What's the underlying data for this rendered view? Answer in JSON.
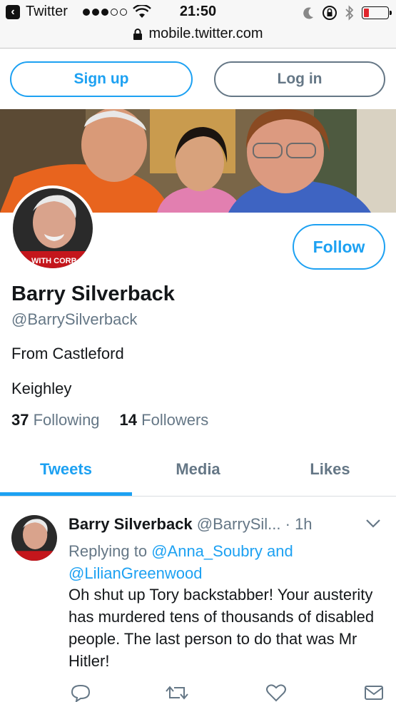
{
  "status_bar": {
    "app": "Twitter",
    "time": "21:50",
    "back_icon": "back-arrow-icon",
    "battery_color": "#e0262d"
  },
  "url_bar": {
    "url": "mobile.twitter.com"
  },
  "auth": {
    "signup_label": "Sign up",
    "login_label": "Log in"
  },
  "profile": {
    "name": "Barry Silverback",
    "handle": "@BarrySilverback",
    "follow_label": "Follow",
    "bio_line1": "From Castleford",
    "bio_line2": "Keighley",
    "following_count": "37",
    "following_label": "Following",
    "followers_count": "14",
    "followers_label": "Followers",
    "avatar_banner_text": "WITH CORB"
  },
  "tabs": [
    {
      "label": "Tweets",
      "active": true
    },
    {
      "label": "Media",
      "active": false
    },
    {
      "label": "Likes",
      "active": false
    }
  ],
  "tweet": {
    "name": "Barry Silverback",
    "handle": "@BarrySil...",
    "separator": "·",
    "time": "1h",
    "replying_prefix": "Replying to",
    "mention1": "@Anna_Soubry",
    "and": "and",
    "mention2": "@LilianGreenwood",
    "text": "Oh shut up Tory backstabber! Your austerity has murdered tens of thousands of disabled people. The last person to do that was Mr Hitler!",
    "actions": [
      "reply-icon",
      "retweet-icon",
      "like-icon",
      "message-icon"
    ]
  },
  "colors": {
    "brand": "#1da1f2",
    "secondary": "#657786",
    "text": "#14171a"
  }
}
